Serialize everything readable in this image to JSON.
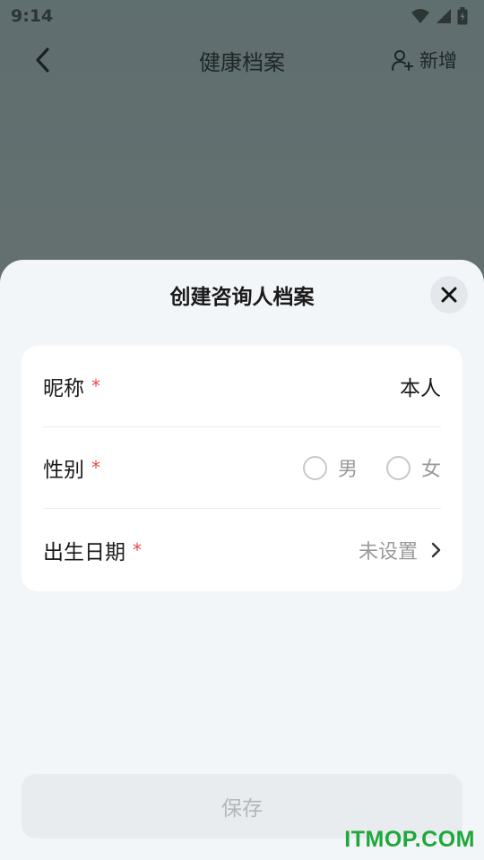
{
  "status_bar": {
    "time": "9:14"
  },
  "header": {
    "title": "健康档案",
    "add_label": "新增",
    "back_icon": "chevron-left-icon",
    "add_icon": "user-plus-icon"
  },
  "sheet": {
    "title": "创建咨询人档案",
    "close_icon": "close-icon",
    "fields": {
      "nickname": {
        "label": "昵称",
        "required_mark": "*",
        "value": "本人"
      },
      "gender": {
        "label": "性别",
        "required_mark": "*",
        "options": [
          "男",
          "女"
        ]
      },
      "birthdate": {
        "label": "出生日期",
        "required_mark": "*",
        "value": "未设置"
      }
    },
    "save_label": "保存"
  },
  "watermark": "ITMOP.COM",
  "colors": {
    "overlay": "#5f6e6f",
    "sheet_bg": "#f3f6f9",
    "required": "#e84a4a",
    "placeholder": "#9a9a9a",
    "button_disabled_bg": "#e8ecef",
    "watermark": "#1fa83a"
  }
}
